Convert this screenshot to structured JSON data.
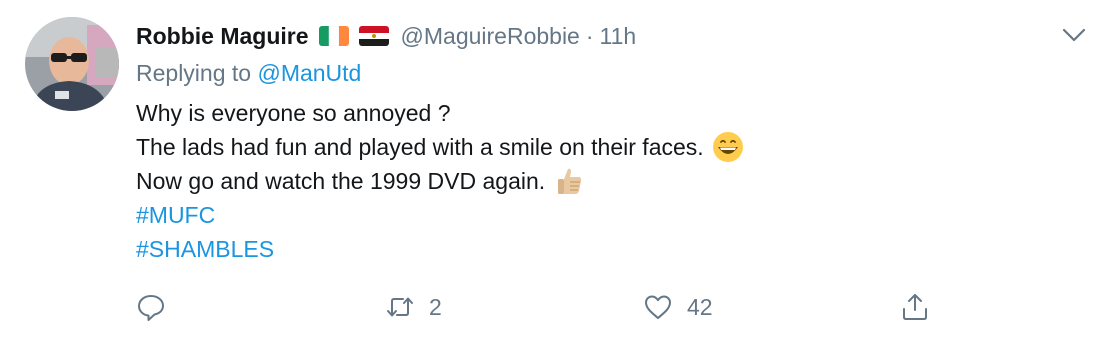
{
  "tweet": {
    "author_name": "Robbie Maguire",
    "handle": "@MaguireRobbie",
    "separator": "·",
    "time": "11h",
    "replying_prefix": "Replying to",
    "replying_handle": "@ManUtd",
    "lines": [
      "Why is everyone so annoyed ?",
      "The lads had fun and played with a smile on their faces.",
      "Now go and watch the 1999 DVD again."
    ],
    "hashtags": [
      "#MUFC",
      "#SHAMBLES"
    ],
    "flags": [
      "ireland-flag-icon",
      "egypt-flag-icon"
    ],
    "emojis": [
      "grinning-face-icon",
      "thumbs-up-icon"
    ]
  },
  "actions": {
    "reply_icon": "reply-icon",
    "retweet_count": "2",
    "like_count": "42",
    "share_icon": "share-icon"
  },
  "colors": {
    "link": "#1b95e0",
    "secondary": "#657786",
    "text": "#14171a"
  }
}
